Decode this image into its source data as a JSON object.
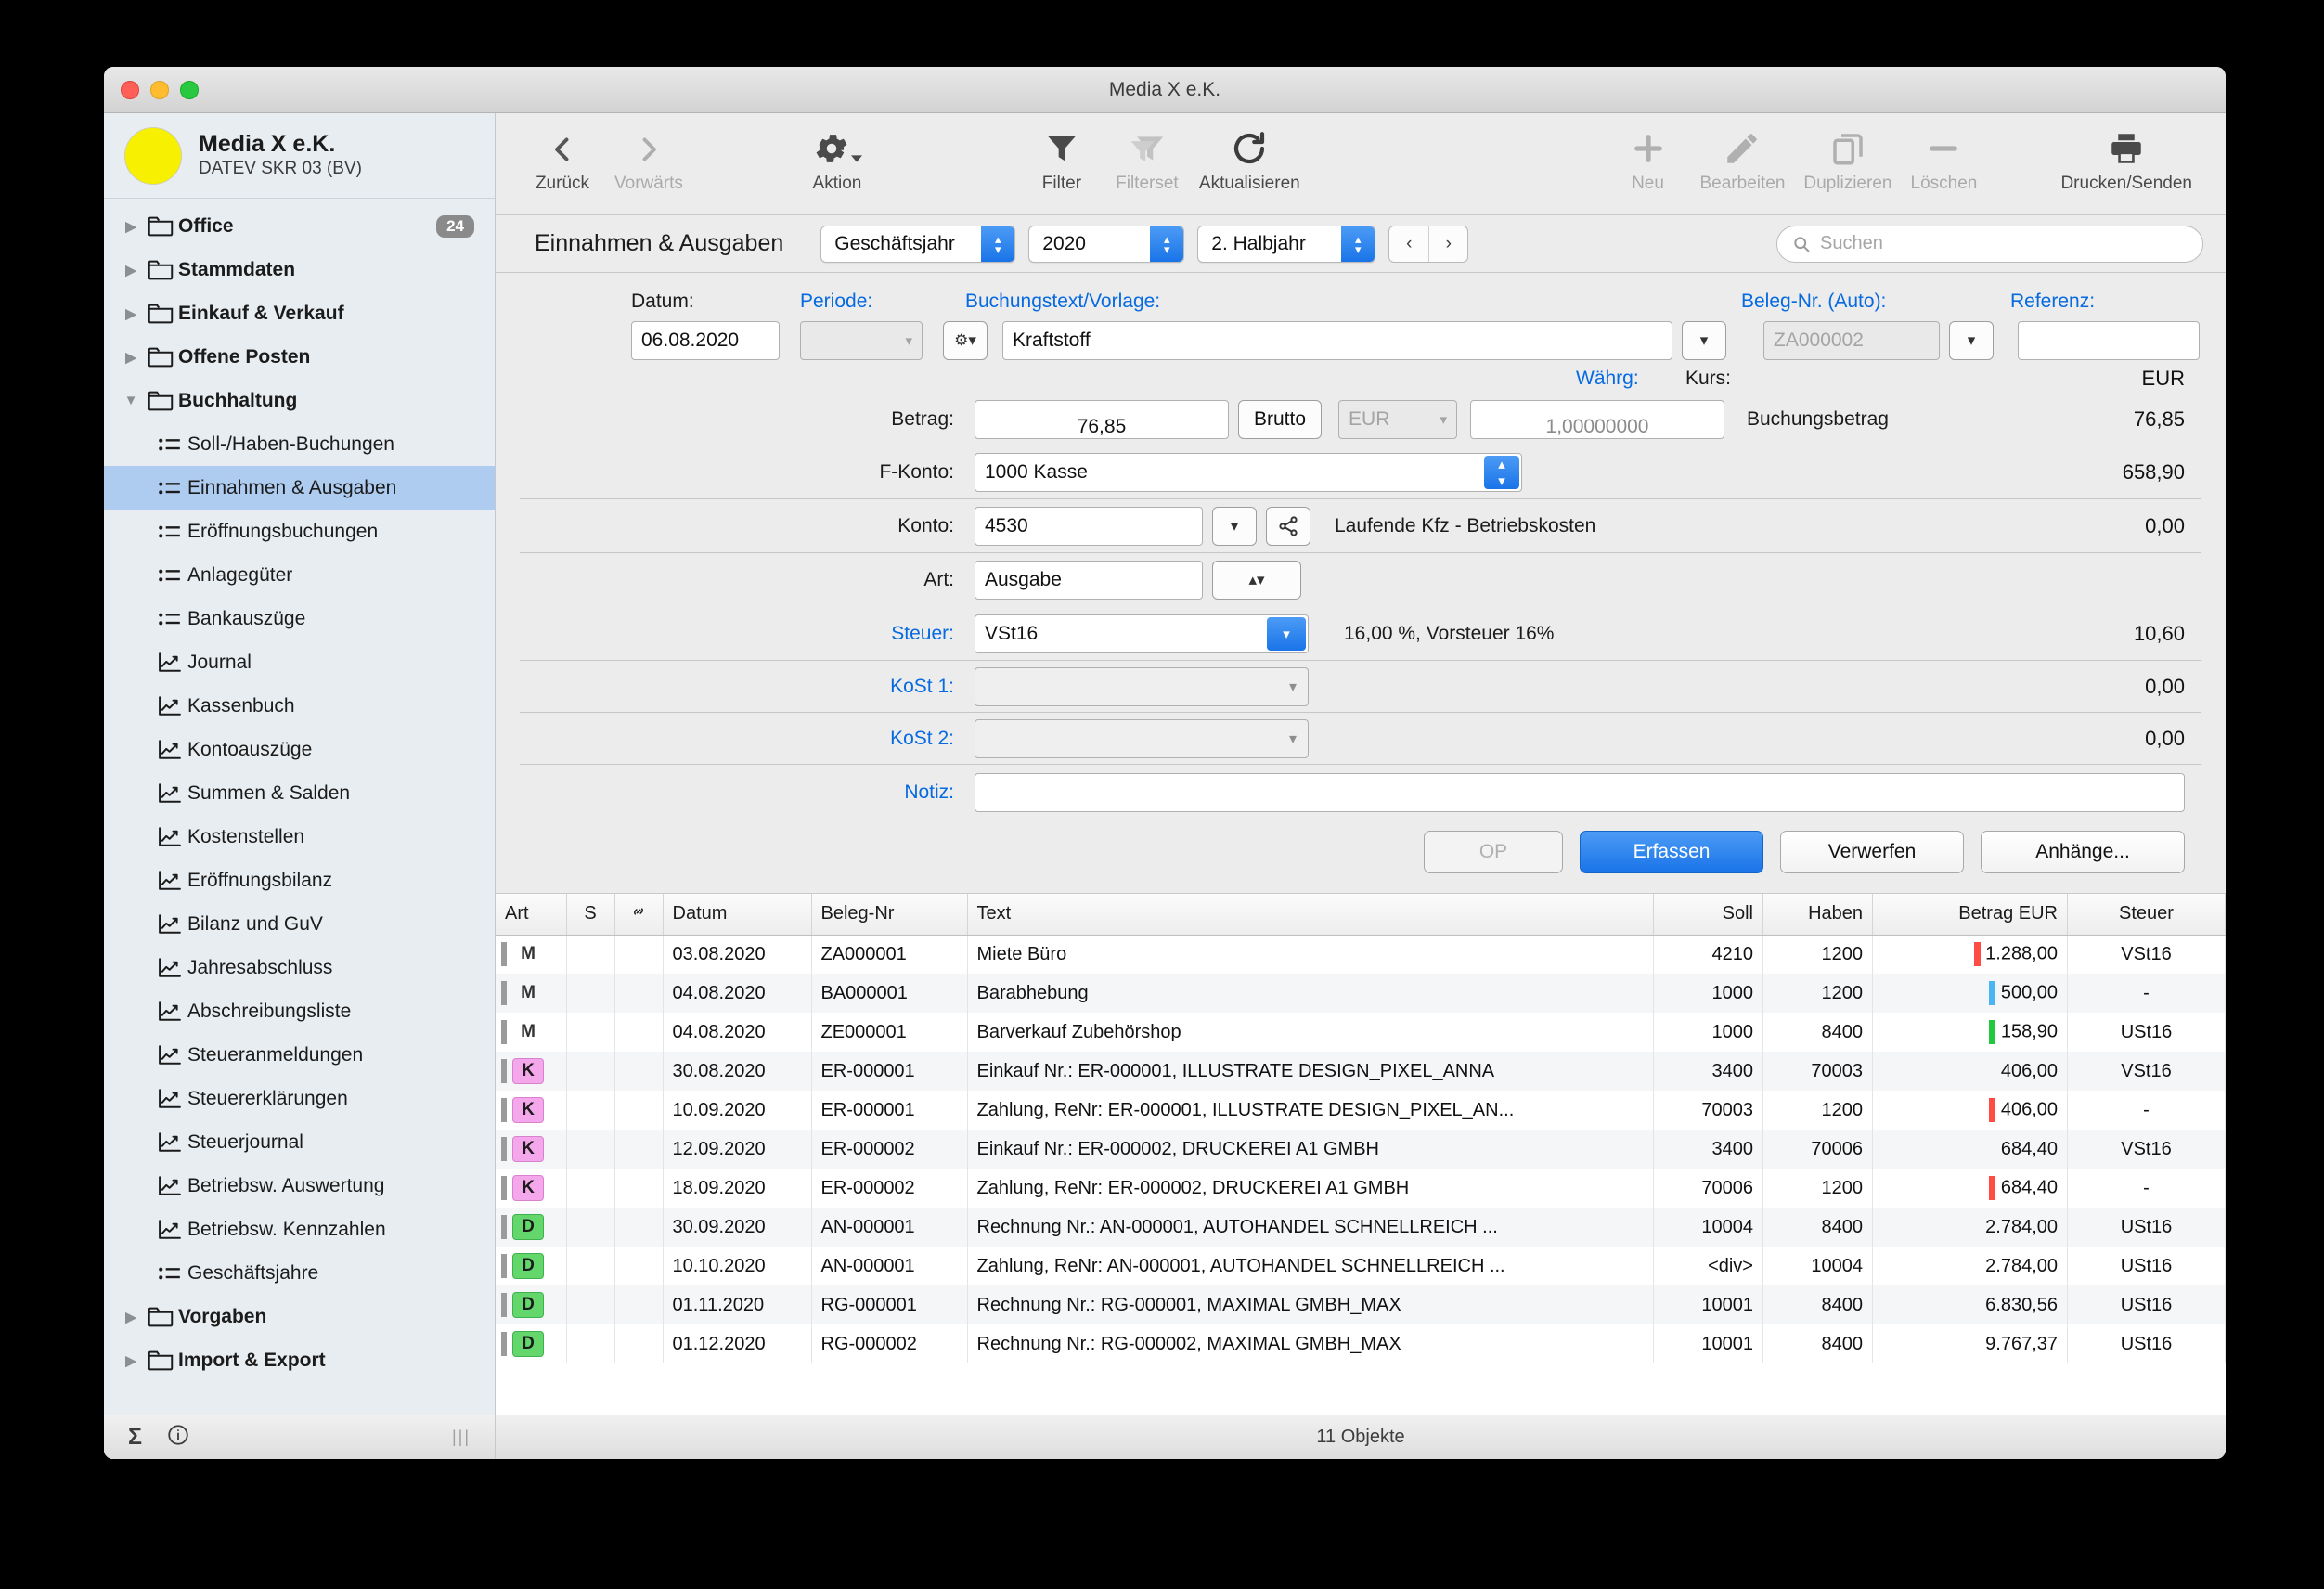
{
  "window": {
    "title": "Media X e.K."
  },
  "company": {
    "name": "Media X e.K.",
    "subtitle": "DATEV SKR 03 (BV)"
  },
  "sidebar": {
    "items": [
      {
        "label": "Office",
        "type": "folder",
        "expanded": false,
        "badge": "24"
      },
      {
        "label": "Stammdaten",
        "type": "folder",
        "expanded": false,
        "badge": ""
      },
      {
        "label": "Einkauf & Verkauf",
        "type": "folder",
        "expanded": false,
        "badge": ""
      },
      {
        "label": "Offene Posten",
        "type": "folder",
        "expanded": false,
        "badge": ""
      },
      {
        "label": "Buchhaltung",
        "type": "folder",
        "expanded": true,
        "badge": ""
      },
      {
        "label": "Soll-/Haben-Buchungen",
        "type": "list",
        "selected": false
      },
      {
        "label": "Einnahmen & Ausgaben",
        "type": "list",
        "selected": true
      },
      {
        "label": "Eröffnungsbuchungen",
        "type": "list",
        "selected": false
      },
      {
        "label": "Anlagegüter",
        "type": "list",
        "selected": false
      },
      {
        "label": "Bankauszüge",
        "type": "list",
        "selected": false
      },
      {
        "label": "Journal",
        "type": "chart",
        "selected": false
      },
      {
        "label": "Kassenbuch",
        "type": "chart",
        "selected": false
      },
      {
        "label": "Kontoauszüge",
        "type": "chart",
        "selected": false
      },
      {
        "label": "Summen & Salden",
        "type": "chart",
        "selected": false
      },
      {
        "label": "Kostenstellen",
        "type": "chart",
        "selected": false
      },
      {
        "label": "Eröffnungsbilanz",
        "type": "chart",
        "selected": false
      },
      {
        "label": "Bilanz und GuV",
        "type": "chart",
        "selected": false
      },
      {
        "label": "Jahresabschluss",
        "type": "chart",
        "selected": false
      },
      {
        "label": "Abschreibungsliste",
        "type": "chart",
        "selected": false
      },
      {
        "label": "Steueranmeldungen",
        "type": "chart",
        "selected": false
      },
      {
        "label": "Steuererklärungen",
        "type": "chart",
        "selected": false
      },
      {
        "label": "Steuerjournal",
        "type": "chart",
        "selected": false
      },
      {
        "label": "Betriebsw. Auswertung",
        "type": "chart",
        "selected": false
      },
      {
        "label": "Betriebsw. Kennzahlen",
        "type": "chart",
        "selected": false
      },
      {
        "label": "Geschäftsjahre",
        "type": "list",
        "selected": false
      },
      {
        "label": "Vorgaben",
        "type": "folder",
        "expanded": false,
        "badge": ""
      },
      {
        "label": "Import & Export",
        "type": "folder",
        "expanded": false,
        "badge": ""
      }
    ]
  },
  "toolbar": {
    "back": "Zurück",
    "forward": "Vorwärts",
    "action": "Aktion",
    "filter": "Filter",
    "filterset": "Filterset",
    "refresh": "Aktualisieren",
    "new": "Neu",
    "edit": "Bearbeiten",
    "duplicate": "Duplizieren",
    "delete": "Löschen",
    "print": "Drucken/Senden"
  },
  "tabbar": {
    "title": "Einnahmen & Ausgaben",
    "period_type": "Geschäftsjahr",
    "year": "2020",
    "half": "2. Halbjahr",
    "prev": "‹",
    "next": "›",
    "search_placeholder": "Suchen"
  },
  "form": {
    "datum_label": "Datum:",
    "datum_value": "06.08.2020",
    "periode_label": "Periode:",
    "periode_value": "",
    "buchungstext_label": "Buchungstext/Vorlage:",
    "buchungstext_value": "Kraftstoff",
    "belegnr_label": "Beleg-Nr. (Auto):",
    "belegnr_value": "ZA000002",
    "referenz_label": "Referenz:",
    "referenz_value": "",
    "currency_header": "EUR",
    "betrag_label": "Betrag:",
    "betrag_value": "76,85",
    "brutto_label": "Brutto",
    "waehrung_label": "Währg:",
    "waehrung_value": "EUR",
    "kurs_label": "Kurs:",
    "kurs_value": "1,00000000",
    "buchungsbetrag_label": "Buchungsbetrag",
    "buchungsbetrag_value": "76,85",
    "fkonto_label": "F-Konto:",
    "fkonto_value": "1000 Kasse",
    "fkonto_amount": "658,90",
    "konto_label": "Konto:",
    "konto_value": "4530",
    "konto_desc": "Laufende Kfz - Betriebskosten",
    "konto_amount": "0,00",
    "art_label": "Art:",
    "art_value": "Ausgabe",
    "steuer_label": "Steuer:",
    "steuer_value": "VSt16",
    "steuer_desc": "16,00 %, Vorsteuer 16%",
    "steuer_amount": "10,60",
    "kost1_label": "KoSt 1:",
    "kost1_value": "",
    "kost1_amount": "0,00",
    "kost2_label": "KoSt 2:",
    "kost2_value": "",
    "kost2_amount": "0,00",
    "notiz_label": "Notiz:",
    "notiz_value": "",
    "op_button": "OP",
    "erfassen_button": "Erfassen",
    "verwerfen_button": "Verwerfen",
    "anhaenge_button": "Anhänge..."
  },
  "table": {
    "columns": [
      "Art",
      "S",
      "link",
      "Datum",
      "Beleg-Nr",
      "Text",
      "Soll",
      "Haben",
      "Betrag EUR",
      "Steuer"
    ],
    "rows": [
      {
        "art": "M",
        "kind": "m",
        "s": "",
        "datum": "03.08.2020",
        "beleg": "ZA000001",
        "text": "Miete Büro",
        "soll": "4210",
        "haben": "1200",
        "bar": "#ff4d45",
        "betrag": "1.288,00",
        "steuer": "VSt16"
      },
      {
        "art": "M",
        "kind": "m",
        "s": "",
        "datum": "04.08.2020",
        "beleg": "BA000001",
        "text": "Barabhebung",
        "soll": "1000",
        "haben": "1200",
        "bar": "#4bb4f5",
        "betrag": "500,00",
        "steuer": "-"
      },
      {
        "art": "M",
        "kind": "m",
        "s": "",
        "datum": "04.08.2020",
        "beleg": "ZE000001",
        "text": "Barverkauf Zubehörshop",
        "soll": "1000",
        "haben": "8400",
        "bar": "#22c93f",
        "betrag": "158,90",
        "steuer": "USt16"
      },
      {
        "art": "K",
        "kind": "k",
        "s": "",
        "datum": "30.08.2020",
        "beleg": "ER-000001",
        "text": "Einkauf Nr.: ER-000001, ILLUSTRATE DESIGN_PIXEL_ANNA",
        "soll": "3400",
        "haben": "70003",
        "bar": "",
        "betrag": "406,00",
        "steuer": "VSt16"
      },
      {
        "art": "K",
        "kind": "k",
        "s": "",
        "datum": "10.09.2020",
        "beleg": "ER-000001",
        "text": "Zahlung, ReNr: ER-000001, ILLUSTRATE DESIGN_PIXEL_AN...",
        "soll": "70003",
        "haben": "1200",
        "bar": "#ff4d45",
        "betrag": "406,00",
        "steuer": "-"
      },
      {
        "art": "K",
        "kind": "k",
        "s": "",
        "datum": "12.09.2020",
        "beleg": "ER-000002",
        "text": "Einkauf Nr.: ER-000002, DRUCKEREI A1 GMBH",
        "soll": "3400",
        "haben": "70006",
        "bar": "",
        "betrag": "684,40",
        "steuer": "VSt16"
      },
      {
        "art": "K",
        "kind": "k",
        "s": "",
        "datum": "18.09.2020",
        "beleg": "ER-000002",
        "text": "Zahlung, ReNr: ER-000002, DRUCKEREI A1 GMBH",
        "soll": "70006",
        "haben": "1200",
        "bar": "#ff4d45",
        "betrag": "684,40",
        "steuer": "-"
      },
      {
        "art": "D",
        "kind": "d",
        "s": "",
        "datum": "30.09.2020",
        "beleg": "AN-000001",
        "text": "Rechnung Nr.: AN-000001, AUTOHANDEL SCHNELLREICH ...",
        "soll": "10004",
        "haben": "8400",
        "bar": "",
        "betrag": "2.784,00",
        "steuer": "USt16"
      },
      {
        "art": "D",
        "kind": "d",
        "s": "",
        "datum": "10.10.2020",
        "beleg": "AN-000001",
        "text": "Zahlung, ReNr: AN-000001, AUTOHANDEL SCHNELLREICH ...",
        "soll": "<div>",
        "haben": "10004",
        "bar": "",
        "betrag": "2.784,00",
        "steuer": "USt16"
      },
      {
        "art": "D",
        "kind": "d",
        "s": "",
        "datum": "01.11.2020",
        "beleg": "RG-000001",
        "text": "Rechnung Nr.: RG-000001, MAXIMAL GMBH_MAX",
        "soll": "10001",
        "haben": "8400",
        "bar": "",
        "betrag": "6.830,56",
        "steuer": "USt16"
      },
      {
        "art": "D",
        "kind": "d",
        "s": "",
        "datum": "01.12.2020",
        "beleg": "RG-000002",
        "text": "Rechnung Nr.: RG-000002, MAXIMAL GMBH_MAX",
        "soll": "10001",
        "haben": "8400",
        "bar": "",
        "betrag": "9.767,37",
        "steuer": "USt16"
      }
    ]
  },
  "statusbar": {
    "text": "11 Objekte"
  }
}
